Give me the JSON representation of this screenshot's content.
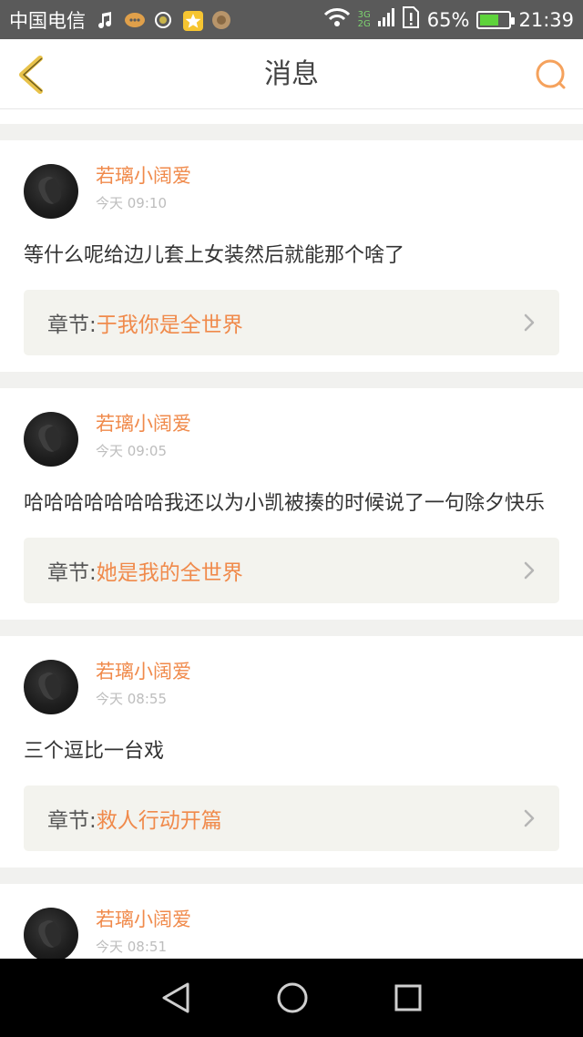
{
  "status_bar": {
    "carrier": "中国电信",
    "network": [
      "3G",
      "2G"
    ],
    "battery": "65%",
    "battery_level": 0.65,
    "time": "21:39"
  },
  "header": {
    "title": "消息"
  },
  "messages": [
    {
      "username": "若璃小阔爱",
      "time": "今天 09:10",
      "text": "等什么呢给边儿套上女装然后就能那个啥了",
      "chapter_label": "章节:",
      "chapter_name": "于我你是全世界"
    },
    {
      "username": "若璃小阔爱",
      "time": "今天 09:05",
      "text": "哈哈哈哈哈哈哈我还以为小凯被揍的时候说了一句除夕快乐",
      "chapter_label": "章节:",
      "chapter_name": "她是我的全世界"
    },
    {
      "username": "若璃小阔爱",
      "time": "今天 08:55",
      "text": "三个逗比一台戏",
      "chapter_label": "章节:",
      "chapter_name": "救人行动开篇"
    },
    {
      "username": "若璃小阔爱",
      "time": "今天 08:51",
      "text": "",
      "chapter_label": "",
      "chapter_name": ""
    }
  ],
  "colors": {
    "accent": "#f08a4b",
    "back_arrow": "#e8c24a",
    "search": "#f5a25d"
  }
}
